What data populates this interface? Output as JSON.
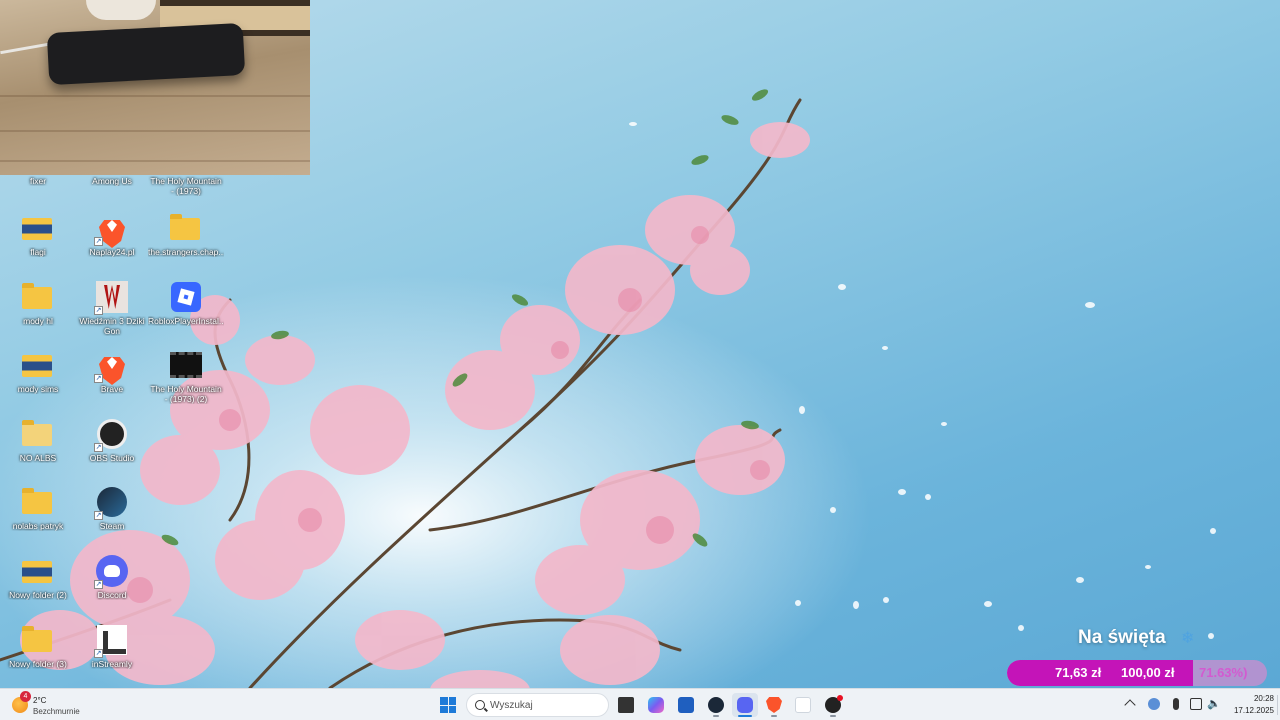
{
  "desktop": {
    "icons": [
      {
        "label": "fixer",
        "kind": "folder"
      },
      {
        "label": "Among Us",
        "kind": "app"
      },
      {
        "label": "The Holy Mountain - (1973)",
        "kind": "video"
      },
      {
        "label": "flagi",
        "kind": "folder"
      },
      {
        "label": "Naplay24.pl",
        "kind": "brave"
      },
      {
        "label": "the.strangers.chap...",
        "kind": "folder"
      },
      {
        "label": "mody hl",
        "kind": "folder"
      },
      {
        "label": "Wiedźmin 3 Dziki Gon",
        "kind": "witcher"
      },
      {
        "label": "RobloxPlayerInstal...",
        "kind": "roblox"
      },
      {
        "label": "mody sims",
        "kind": "folder"
      },
      {
        "label": "Brave",
        "kind": "brave"
      },
      {
        "label": "The Holy Mountain - (1973) (2)",
        "kind": "video"
      },
      {
        "label": "NO ALBS",
        "kind": "folder"
      },
      {
        "label": "OBS Studio",
        "kind": "obs"
      },
      {
        "label": "nolabs patryk",
        "kind": "folder"
      },
      {
        "label": "Steam",
        "kind": "steam"
      },
      {
        "label": "Nowy folder (2)",
        "kind": "folder"
      },
      {
        "label": "Discord",
        "kind": "discord"
      },
      {
        "label": "Nowy folder (3)",
        "kind": "folder"
      },
      {
        "label": "inStreamly",
        "kind": "instreamly"
      }
    ]
  },
  "donation_goal": {
    "title": "Na święta",
    "snow_icon": "snowflake-icon",
    "current": "71,63 zł",
    "target": "100,00 zł",
    "percent_label": "71.63%)",
    "progress": 0.7163,
    "fill_color": "#c414b8"
  },
  "taskbar": {
    "weather": {
      "badge": "4",
      "temp": "2°C",
      "desc": "Bezchmurnie"
    },
    "search_placeholder": "Wyszukaj",
    "apps": [
      {
        "name": "task-view",
        "color": "#333333"
      },
      {
        "name": "copilot",
        "color": "#7b5cf0"
      },
      {
        "name": "store",
        "color": "#1f5fbf"
      },
      {
        "name": "steam",
        "color": "#1b2838"
      },
      {
        "name": "discord",
        "color": "#5865f2"
      },
      {
        "name": "brave",
        "color": "#fb542b"
      },
      {
        "name": "notepad",
        "color": "#ffffff"
      },
      {
        "name": "obs",
        "color": "#222222"
      }
    ],
    "clock": {
      "time": "20:28",
      "date": "17.12.2025"
    }
  }
}
